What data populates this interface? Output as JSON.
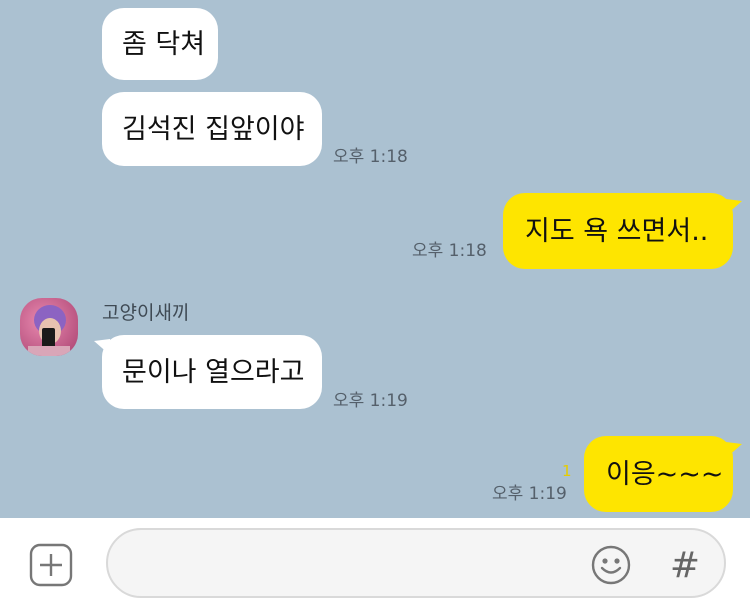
{
  "messages": [
    {
      "text": "좀 닥쳐",
      "direction": "incoming"
    },
    {
      "text": "김석진 집앞이야",
      "direction": "incoming",
      "time": "오후 1:18"
    },
    {
      "text": "지도 욕 쓰면서..",
      "direction": "outgoing",
      "time": "오후 1:18"
    },
    {
      "sender": "고양이새끼",
      "text": "문이나 열으라고",
      "direction": "incoming",
      "time": "오후 1:19"
    },
    {
      "text": "이응~~~",
      "direction": "outgoing",
      "time": "오후 1:19",
      "unread_count": "1"
    }
  ],
  "input": {
    "value": "",
    "plus_icon": "plus-square-icon",
    "emoji_icon": "smiley-icon",
    "hash_label": "#"
  },
  "colors": {
    "chat_background": "#abc1d1",
    "outgoing_bubble": "#fee500",
    "incoming_bubble": "#ffffff",
    "unread": "#e6cc00"
  }
}
